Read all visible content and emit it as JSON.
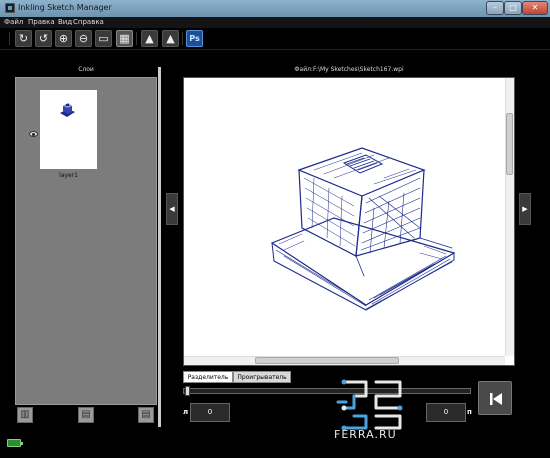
{
  "window": {
    "title": "Inkling Sketch Manager",
    "controls": {
      "minimize": "–",
      "maximize": "□",
      "close": "✕"
    }
  },
  "menu": {
    "items": [
      "Файл",
      "Правка",
      "Вид",
      "Справка"
    ]
  },
  "toolbar": {
    "buttons": [
      {
        "icon": "rotate-right-icon",
        "glyph": "↻"
      },
      {
        "icon": "rotate-left-icon",
        "glyph": "↺"
      },
      {
        "icon": "zoom-in-icon",
        "glyph": "⊕"
      },
      {
        "icon": "zoom-out-icon",
        "glyph": "⊖"
      },
      {
        "icon": "fit-page-icon",
        "glyph": "▭"
      },
      {
        "icon": "actual-size-icon",
        "glyph": "▦"
      },
      {
        "icon": "import-icon",
        "glyph": "▲"
      },
      {
        "icon": "export-icon",
        "glyph": "▲"
      },
      {
        "icon": "photoshop-icon",
        "glyph": "Ps"
      }
    ]
  },
  "layers_panel": {
    "title": "Слои",
    "layers": [
      {
        "name": "layer1"
      }
    ],
    "bottom_buttons": [
      {
        "icon": "delete-layer-icon",
        "glyph": "▥"
      },
      {
        "icon": "new-layer-icon",
        "glyph": "▤"
      },
      {
        "icon": "duplicate-layer-icon",
        "glyph": "▤"
      }
    ]
  },
  "canvas": {
    "file_path": "Файл:F:\\My Sketches\\Sketch167.wpi"
  },
  "navigation": {
    "prev": "◀",
    "next": "▶"
  },
  "playback": {
    "tabs": [
      "Разделитель",
      "Проигрыватель"
    ],
    "active_tab": "Разделитель",
    "left_label": "л",
    "left_value": "0",
    "right_label": "п",
    "right_value": "0",
    "slider_position": 0
  },
  "watermark": {
    "text": "FERRA.RU"
  },
  "colors": {
    "titlebar": "#7fa4c2",
    "background": "#000000",
    "panel_gray": "#7c7c7c",
    "sketch_ink": "#1c2a8c",
    "photoshop_blue": "#1b4f9a"
  }
}
